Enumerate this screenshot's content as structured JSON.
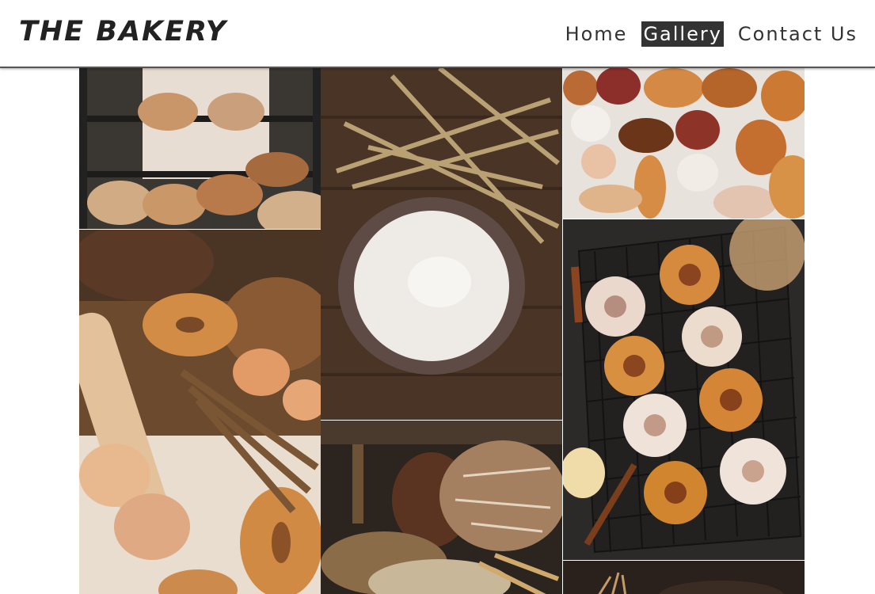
{
  "header": {
    "logo": "THE BAKERY",
    "nav": [
      {
        "label": "Home",
        "active": false
      },
      {
        "label": "Gallery",
        "active": true
      },
      {
        "label": "Contact Us",
        "active": false
      }
    ]
  },
  "gallery": {
    "photos": [
      {
        "subject": "bread loaves on bakery rack"
      },
      {
        "subject": "bagels, rolling pin and wheat"
      },
      {
        "subject": "wheat and bowl of flour"
      },
      {
        "subject": "rustic bread with wheat ears"
      },
      {
        "subject": "assorted pastries"
      },
      {
        "subject": "cinnamon rolls on cooling rack"
      },
      {
        "subject": "dark bread photo"
      }
    ]
  }
}
